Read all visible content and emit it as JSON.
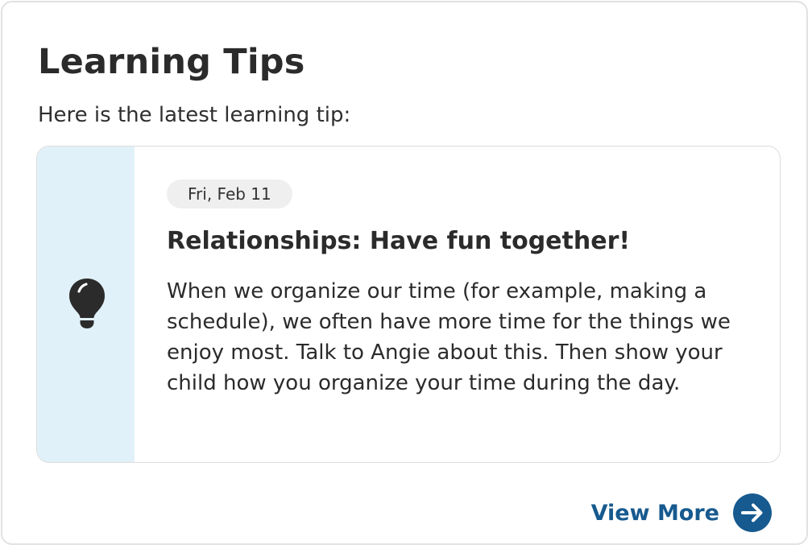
{
  "header": {
    "title": "Learning Tips",
    "subtitle": "Here is the latest learning tip:"
  },
  "tip": {
    "icon": "lightbulb-icon",
    "date": "Fri, Feb 11",
    "heading": "Relationships: Have fun together!",
    "body": "When we organize our time (for example, making a schedule), we often have more time for the things we enjoy most. Talk to Angie about this. Then show your child how you organize your time during the day."
  },
  "footer": {
    "view_more_label": "View More",
    "view_more_icon": "arrow-right-circle-icon"
  },
  "colors": {
    "accent": "#165a8f",
    "stripe": "#e1f1f9",
    "chip": "#efefef",
    "text": "#2b2b2b"
  }
}
